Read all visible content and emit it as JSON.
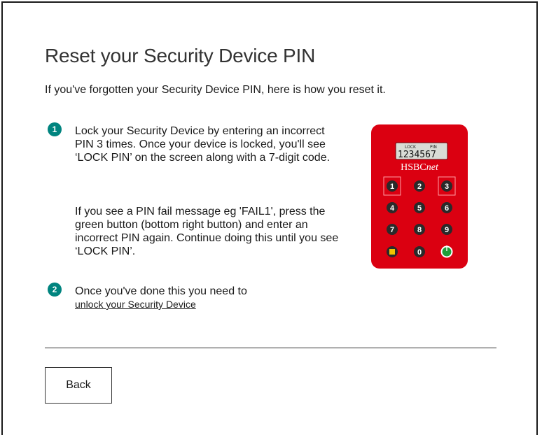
{
  "page": {
    "title": "Reset your Security Device PIN",
    "intro": "If you've forgotten your Security Device PIN, here is how you reset it."
  },
  "steps": [
    {
      "number": "1",
      "paragraphs": [
        "Lock your Security Device by entering an incorrect PIN 3 times. Once your device is locked, you'll see ‘LOCK PIN’ on the screen along with a 7-digit code.",
        "If you see a PIN fail message eg 'FAIL1', press the green button (bottom right button) and enter an incorrect PIN again. Continue doing this until you see ‘LOCK PIN’."
      ]
    },
    {
      "number": "2",
      "text": "Once you've done this you need to",
      "link": "unlock your Security Device"
    }
  ],
  "device": {
    "screen_labels": [
      "LOCK",
      "PIN"
    ],
    "screen_code": "1234567",
    "brand_prefix": "HSBC",
    "brand_suffix": "net",
    "keys": [
      "1",
      "2",
      "3",
      "4",
      "5",
      "6",
      "7",
      "8",
      "9",
      "0"
    ],
    "body_color": "#db0011",
    "accent_color": "#00847f"
  },
  "footer": {
    "back_label": "Back"
  }
}
